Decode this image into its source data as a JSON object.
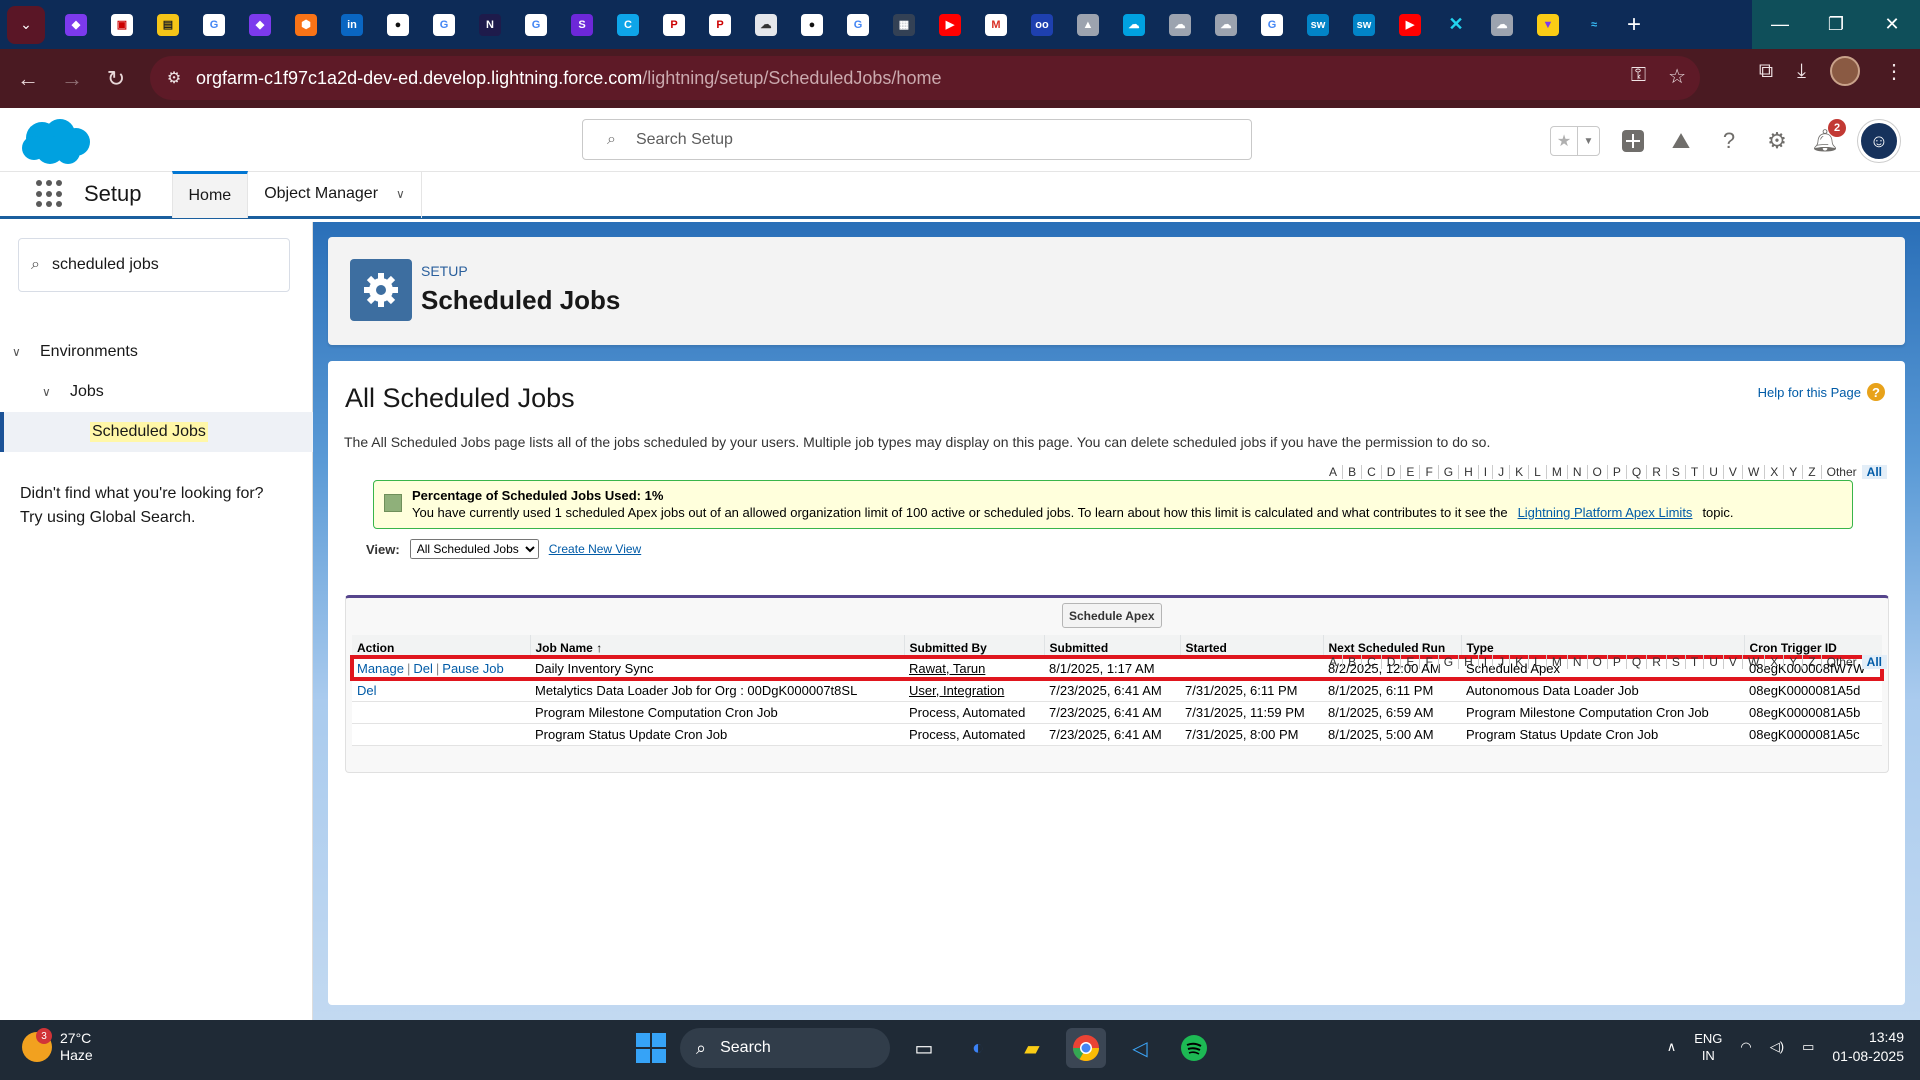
{
  "browser": {
    "url_host": "orgfarm-c1f97c1a2d-dev-ed.develop.lightning.force.com",
    "url_path": "/lightning/setup/ScheduledJobs/home",
    "window_controls": {
      "minimize": "—",
      "restore": "❐",
      "close": "✕"
    }
  },
  "header": {
    "search_placeholder": "Search Setup",
    "notification_count": "2"
  },
  "nav": {
    "app_name": "Setup",
    "tabs": [
      {
        "label": "Home",
        "active": true
      },
      {
        "label": "Object Manager",
        "active": false
      }
    ]
  },
  "sidebar": {
    "quickfind_value": "scheduled jobs",
    "tree": [
      {
        "label": "Environments",
        "level": 0
      },
      {
        "label": "Jobs",
        "level": 1
      },
      {
        "label": "Scheduled Jobs",
        "level": 2,
        "selected": true
      }
    ],
    "not_found_line1": "Didn't find what you're looking for?",
    "not_found_line2": "Try using Global Search."
  },
  "page_header": {
    "eyebrow": "SETUP",
    "title": "Scheduled Jobs"
  },
  "content": {
    "title": "All Scheduled Jobs",
    "help_link": "Help for this Page",
    "description": "The All Scheduled Jobs page lists all of the jobs scheduled by your users. Multiple job types may display on this page. You can delete scheduled jobs if you have the permission to do so.",
    "info_title": "Percentage of Scheduled Jobs Used: 1%",
    "info_body": "You have currently used 1 scheduled Apex jobs out of an allowed organization limit of 100 active or scheduled jobs. To learn about how this limit is calculated and what contributes to it see the",
    "info_link": "Lightning Platform Apex Limits",
    "info_suffix": "topic.",
    "view_label": "View:",
    "view_selected": "All Scheduled Jobs",
    "create_view": "Create New View",
    "alpha": [
      "A",
      "B",
      "C",
      "D",
      "E",
      "F",
      "G",
      "H",
      "I",
      "J",
      "K",
      "L",
      "M",
      "N",
      "O",
      "P",
      "Q",
      "R",
      "S",
      "T",
      "U",
      "V",
      "W",
      "X",
      "Y",
      "Z",
      "Other",
      "All"
    ],
    "schedule_button": "Schedule Apex"
  },
  "table": {
    "columns": [
      "Action",
      "Job Name",
      "Submitted By",
      "Submitted",
      "Started",
      "Next Scheduled Run",
      "Type",
      "Cron Trigger ID"
    ],
    "sort_indicator": "↑",
    "rows": [
      {
        "actions": [
          "Manage",
          "Del",
          "Pause Job"
        ],
        "job_name": "Daily Inventory Sync",
        "submitted_by": "Rawat, Tarun",
        "submitted_by_link": true,
        "submitted": "8/1/2025, 1:17 AM",
        "started": "",
        "next_run": "8/2/2025, 12:00 AM",
        "type": "Scheduled Apex",
        "cron_id": "08egK000008fW7W",
        "highlighted": true
      },
      {
        "actions": [
          "Del"
        ],
        "job_name": "Metalytics Data Loader Job for Org : 00DgK000007t8SL",
        "submitted_by": "User, Integration",
        "submitted_by_link": true,
        "submitted": "7/23/2025, 6:41 AM",
        "started": "7/31/2025, 6:11 PM",
        "next_run": "8/1/2025, 6:11 PM",
        "type": "Autonomous Data Loader Job",
        "cron_id": "08egK0000081A5d",
        "highlighted": false
      },
      {
        "actions": [],
        "job_name": "Program Milestone Computation Cron Job",
        "submitted_by": "Process, Automated",
        "submitted_by_link": false,
        "submitted": "7/23/2025, 6:41 AM",
        "started": "7/31/2025, 11:59 PM",
        "next_run": "8/1/2025, 6:59 AM",
        "type": "Program Milestone Computation Cron Job",
        "cron_id": "08egK0000081A5b",
        "highlighted": false
      },
      {
        "actions": [],
        "job_name": "Program Status Update Cron Job",
        "submitted_by": "Process, Automated",
        "submitted_by_link": false,
        "submitted": "7/23/2025, 6:41 AM",
        "started": "7/31/2025, 8:00 PM",
        "next_run": "8/1/2025, 5:00 AM",
        "type": "Program Status Update Cron Job",
        "cron_id": "08egK0000081A5c",
        "highlighted": false
      }
    ]
  },
  "taskbar": {
    "weather_badge": "3",
    "temperature": "27°C",
    "condition": "Haze",
    "search_label": "Search",
    "lang_top": "ENG",
    "lang_bottom": "IN",
    "time": "13:49",
    "date": "01-08-2025"
  }
}
